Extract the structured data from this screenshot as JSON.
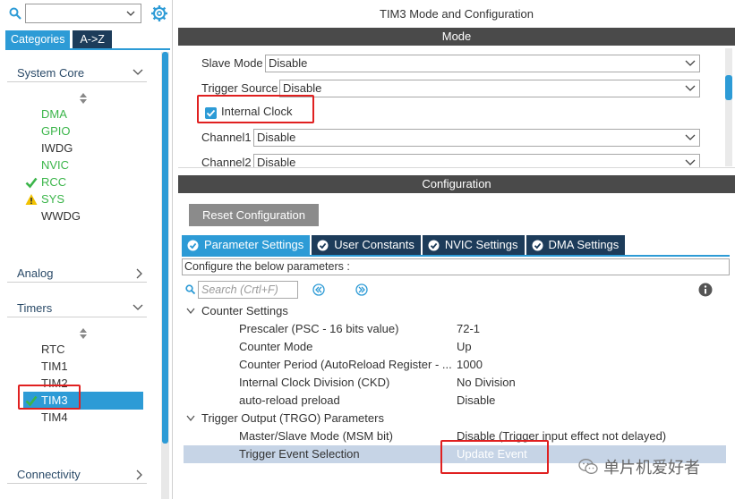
{
  "left": {
    "tabs": [
      "Categories",
      "A->Z"
    ],
    "categories": [
      {
        "label": "System Core",
        "expanded": true,
        "items": [
          {
            "label": "DMA",
            "status": "",
            "color": "#3bb54a"
          },
          {
            "label": "GPIO",
            "status": "",
            "color": "#3bb54a"
          },
          {
            "label": "IWDG",
            "status": "",
            "color": "#333333"
          },
          {
            "label": "NVIC",
            "status": "",
            "color": "#3bb54a"
          },
          {
            "label": "RCC",
            "status": "check",
            "color": "#3bb54a"
          },
          {
            "label": "SYS",
            "status": "warning",
            "color": "#3bb54a"
          },
          {
            "label": "WWDG",
            "status": "",
            "color": "#333333"
          }
        ]
      },
      {
        "label": "Analog",
        "expanded": false
      },
      {
        "label": "Timers",
        "expanded": true,
        "items": [
          {
            "label": "RTC",
            "status": ""
          },
          {
            "label": "TIM1",
            "status": ""
          },
          {
            "label": "TIM2",
            "status": ""
          },
          {
            "label": "TIM3",
            "status": "check",
            "selected": true
          },
          {
            "label": "TIM4",
            "status": ""
          }
        ]
      },
      {
        "label": "Connectivity",
        "expanded": false
      }
    ]
  },
  "right": {
    "window_title": "TIM3 Mode and Configuration",
    "mode_header": "Mode",
    "mode": {
      "slave_mode_label": "Slave Mode",
      "slave_mode_value": "Disable",
      "trigger_source_label": "Trigger Source",
      "trigger_source_value": "Disable",
      "internal_clock_label": "Internal Clock",
      "internal_clock_checked": true,
      "channel1_label": "Channel1",
      "channel1_value": "Disable",
      "channel2_label": "Channel2",
      "channel2_value": "Disable"
    },
    "config_header": "Configuration",
    "reset_button": "Reset Configuration",
    "param_tabs": [
      "Parameter Settings",
      "User Constants",
      "NVIC Settings",
      "DMA Settings"
    ],
    "configure_text": "Configure the below parameters :",
    "search_placeholder": "Search (Crtl+F)",
    "groups": [
      {
        "label": "Counter Settings",
        "params": [
          {
            "name": "Prescaler (PSC - 16 bits value)",
            "value": "72-1"
          },
          {
            "name": "Counter Mode",
            "value": "Up"
          },
          {
            "name": "Counter Period (AutoReload Register - ...",
            "value": "1000"
          },
          {
            "name": "Internal Clock Division (CKD)",
            "value": "No Division"
          },
          {
            "name": "auto-reload preload",
            "value": "Disable"
          }
        ]
      },
      {
        "label": "Trigger Output (TRGO) Parameters",
        "params": [
          {
            "name": "Master/Slave Mode (MSM bit)",
            "value": "Disable (Trigger input effect not delayed)"
          },
          {
            "name": "Trigger Event Selection",
            "value": "Update Event",
            "selected": true
          }
        ]
      }
    ],
    "watermark": "单片机爱好者"
  },
  "colors": {
    "accent": "#2d9bd6",
    "dark_tab": "#1d3c5a",
    "header_bar": "#4a4a4a",
    "highlight": "#e02020",
    "ok_green": "#3bb54a",
    "warning": "#f2c200"
  }
}
